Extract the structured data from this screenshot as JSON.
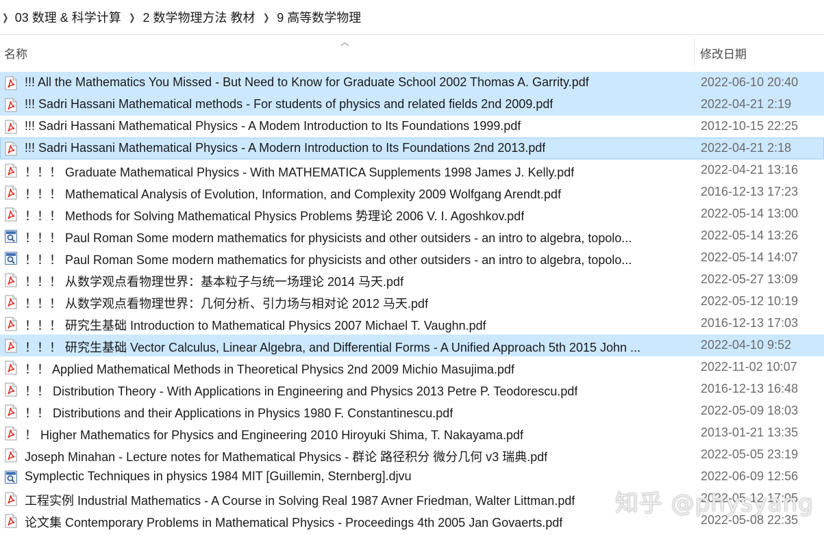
{
  "breadcrumb": {
    "items": [
      "03 数理 & 科学计算",
      "2 数学物理方法 教材",
      "9 高等数学物理"
    ],
    "separator": "›"
  },
  "columns": {
    "name": "名称",
    "date": "修改日期",
    "sort_indicator": "^"
  },
  "files": [
    {
      "name": "!!! All the Mathematics You Missed - But Need to Know for Graduate School  2002 Thomas A. Garrity.pdf",
      "date": "2022-06-10 20:40",
      "icon": "pdf-icon",
      "selected": true
    },
    {
      "name": "!!! Sadri Hassani   Mathematical methods - For students of physics and related fields  2nd 2009.pdf",
      "date": "2022-04-21 2:19",
      "icon": "pdf-icon",
      "selected": true
    },
    {
      "name": "!!! Sadri Hassani   Mathematical Physics - A Modem Introduction to Its Foundations  1999.pdf",
      "date": "2012-10-15 22:25",
      "icon": "pdf-icon",
      "selected": false
    },
    {
      "name": "!!! Sadri Hassani   Mathematical Physics - A Modern Introduction to Its Foundations  2nd 2013.pdf",
      "date": "2022-04-21 2:18",
      "icon": "pdf-icon",
      "selected": true
    },
    {
      "name": "！！！ Graduate Mathematical Physics - With MATHEMATICA Supplements  1998 James J. Kelly.pdf",
      "date": "2022-04-21 13:16",
      "icon": "pdf-icon",
      "selected": false
    },
    {
      "name": "！！！ Mathematical Analysis of Evolution, Information, and Complexity  2009 Wolfgang Arendt.pdf",
      "date": "2016-12-13 17:23",
      "icon": "pdf-icon",
      "selected": false
    },
    {
      "name": "！！！ Methods for Solving Mathematical Physics Problems 势理论  2006 V. I. Agoshkov.pdf",
      "date": "2022-05-14 13:00",
      "icon": "pdf-icon",
      "selected": false
    },
    {
      "name": "！！！ Paul Roman   Some modern mathematics for physicists and other outsiders - an intro to algebra, topolo...",
      "date": "2022-05-14 13:26",
      "icon": "djvu-icon",
      "selected": false
    },
    {
      "name": "！！！ Paul Roman   Some modern mathematics for physicists and other outsiders - an intro to algebra, topolo...",
      "date": "2022-05-14 14:07",
      "icon": "djvu-icon",
      "selected": false
    },
    {
      "name": "！！！ 从数学观点看物理世界：基本粒子与统一场理论   2014 马天.pdf",
      "date": "2022-05-27 13:09",
      "icon": "pdf-icon",
      "selected": false
    },
    {
      "name": "！！！ 从数学观点看物理世界：几何分析、引力场与相对论  2012 马天.pdf",
      "date": "2022-05-12 10:19",
      "icon": "pdf-icon",
      "selected": false
    },
    {
      "name": "！！！ 研究生基础 Introduction to Mathematical Physics   2007 Michael T. Vaughn.pdf",
      "date": "2016-12-13 17:03",
      "icon": "pdf-icon",
      "selected": false
    },
    {
      "name": "！！！ 研究生基础 Vector Calculus, Linear Algebra, and Differential Forms - A Unified Approach  5th 2015 John ...",
      "date": "2022-04-10 9:52",
      "icon": "pdf-icon",
      "selected": true
    },
    {
      "name": "！！ Applied Mathematical Methods in Theoretical Physics  2nd 2009 Michio Masujima.pdf",
      "date": "2022-11-02 10:07",
      "icon": "pdf-icon",
      "selected": false
    },
    {
      "name": "！！ Distribution Theory - With Applications in Engineering and Physics  2013 Petre P. Teodorescu.pdf",
      "date": "2016-12-13 16:48",
      "icon": "pdf-icon",
      "selected": false
    },
    {
      "name": "！！ Distributions and their Applications in Physics  1980 F. Constantinescu.pdf",
      "date": "2022-05-09 18:03",
      "icon": "pdf-icon",
      "selected": false
    },
    {
      "name": "！ Higher Mathematics for Physics and Engineering   2010 Hiroyuki Shima, T. Nakayama.pdf",
      "date": "2013-01-21 13:35",
      "icon": "pdf-icon",
      "selected": false
    },
    {
      "name": "Joseph Minahan - Lecture notes for Mathematical Physics - 群论 路径积分 微分几何  v3 瑞典.pdf",
      "date": "2022-05-05 23:19",
      "icon": "pdf-icon",
      "selected": false
    },
    {
      "name": "Symplectic Techniques in physics  1984 MIT [Guillemin, Sternberg].djvu",
      "date": "2022-06-09 12:56",
      "icon": "djvu-icon",
      "selected": false
    },
    {
      "name": "工程实例 Industrial Mathematics - A Course in Solving Real  1987 Avner Friedman, Walter Littman.pdf",
      "date": "2022-05-12 17:05",
      "icon": "pdf-icon",
      "selected": false
    },
    {
      "name": "论文集 Contemporary Problems in Mathematical Physics - Proceedings 4th 2005 Jan Govaerts.pdf",
      "date": "2022-05-08 22:35",
      "icon": "pdf-icon",
      "selected": false
    }
  ],
  "watermark": "知乎 @physyang",
  "colors": {
    "selection": "#cce8ff",
    "selection_border": "#99d1ff",
    "pdf_red": "#d9342b",
    "date_gray": "#6b6b6b"
  }
}
